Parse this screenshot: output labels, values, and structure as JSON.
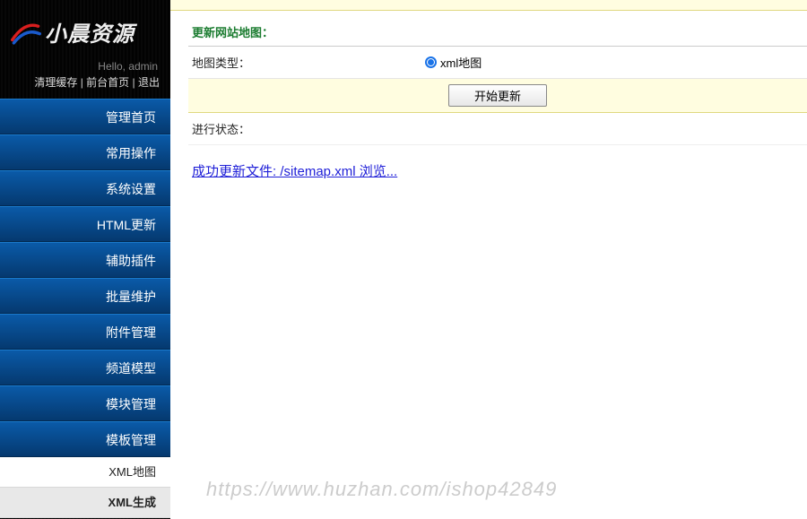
{
  "logo": {
    "text": "小晨资源"
  },
  "hello": "Hello, admin",
  "top_links": {
    "clear_cache": "清理缓存",
    "front_home": "前台首页",
    "logout": "退出",
    "sep": " | "
  },
  "menu": {
    "items": [
      {
        "label": "管理首页"
      },
      {
        "label": "常用操作"
      },
      {
        "label": "系统设置"
      },
      {
        "label": "HTML更新"
      },
      {
        "label": "辅助插件"
      },
      {
        "label": "批量维护"
      },
      {
        "label": "附件管理"
      },
      {
        "label": "频道模型"
      },
      {
        "label": "模块管理"
      },
      {
        "label": "模板管理"
      }
    ],
    "sub_items": [
      {
        "label": "XML地图",
        "active": false
      },
      {
        "label": "XML生成",
        "active": true
      }
    ]
  },
  "panel": {
    "title": "更新网站地图：",
    "type_label": "地图类型：",
    "type_value": "xml地图",
    "button": "开始更新",
    "progress_label": "进行状态：",
    "result_link": "成功更新文件: /sitemap.xml 浏览..."
  },
  "watermark": "https://www.huzhan.com/ishop42849"
}
